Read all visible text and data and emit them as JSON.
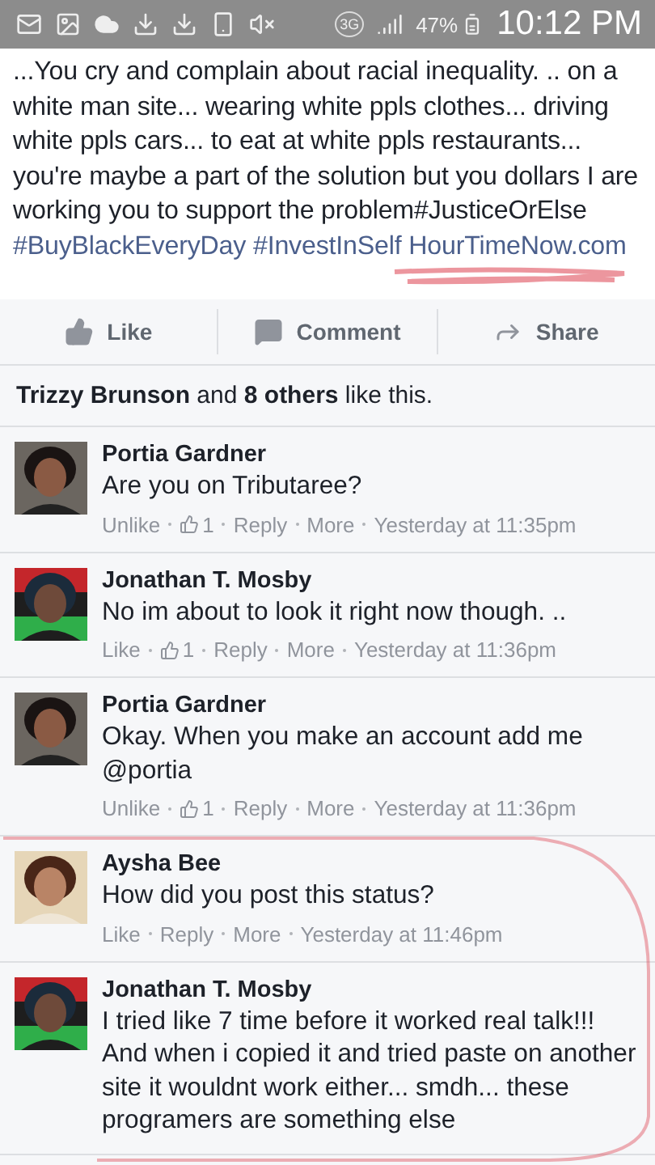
{
  "status_bar": {
    "network": "3G",
    "battery": "47%",
    "time": "10:12 PM"
  },
  "post": {
    "text": "...You cry and complain about racial inequality. .. on a white man site... wearing white ppls clothes... driving white ppls cars... to eat at white ppls restaurants... you're maybe a part of the solution but you dollars I are working you to support the problem#JusticeOrElse",
    "links": [
      "#BuyBlackEveryDay",
      "#InvestInSelf",
      "HourTimeNow.com"
    ]
  },
  "actions": [
    {
      "kind": "like",
      "label": "Like"
    },
    {
      "kind": "comment",
      "label": "Comment"
    },
    {
      "kind": "share",
      "label": "Share"
    }
  ],
  "likes_summary": "**Trizzy Brunson** and **8 others** like this.",
  "comments": [
    {
      "author": "Portia Gardner",
      "text": "Are you on Tributaree?",
      "footer": [
        {
          "kind": "link",
          "text": "Unlike"
        },
        {
          "kind": "count",
          "text": "1"
        },
        {
          "kind": "link",
          "text": "Reply"
        },
        {
          "kind": "link",
          "text": "More"
        },
        {
          "kind": "time",
          "text": "Yesterday at 11:35pm"
        }
      ]
    },
    {
      "author": "Jonathan T. Mosby",
      "text": "No im about to look it right now though. ..",
      "footer": [
        {
          "kind": "link",
          "text": "Like"
        },
        {
          "kind": "count",
          "text": "1"
        },
        {
          "kind": "link",
          "text": "Reply"
        },
        {
          "kind": "link",
          "text": "More"
        },
        {
          "kind": "time",
          "text": "Yesterday at 11:36pm"
        }
      ]
    },
    {
      "author": "Portia Gardner",
      "text": "Okay. When you make an account add me @portia",
      "footer": [
        {
          "kind": "link",
          "text": "Unlike"
        },
        {
          "kind": "count",
          "text": "1"
        },
        {
          "kind": "link",
          "text": "Reply"
        },
        {
          "kind": "link",
          "text": "More"
        },
        {
          "kind": "time",
          "text": "Yesterday at 11:36pm"
        }
      ]
    },
    {
      "author": "Aysha Bee",
      "text": "How did you post this status?",
      "footer": [
        {
          "kind": "link",
          "text": "Like"
        },
        {
          "kind": "link",
          "text": "Reply"
        },
        {
          "kind": "link",
          "text": "More"
        },
        {
          "kind": "time",
          "text": "Yesterday at 11:46pm"
        }
      ]
    },
    {
      "author": "Jonathan T. Mosby",
      "text": "I tried like 7 time before it worked real talk!!! And when i copied it and tried paste on another site it wouldnt work either... smdh... these programers are something else"
    }
  ]
}
